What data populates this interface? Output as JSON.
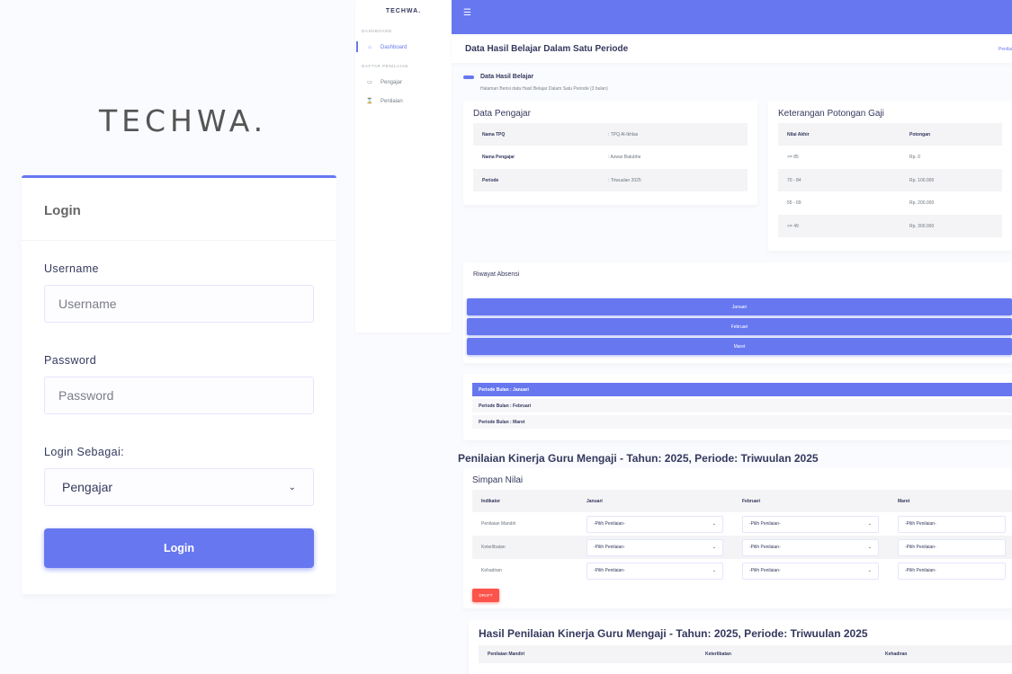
{
  "login": {
    "brand": "TECHWA.",
    "title": "Login",
    "username_label": "Username",
    "username_placeholder": "Username",
    "password_label": "Password",
    "password_placeholder": "Password",
    "role_label": "Login Sebagai:",
    "role_value": "Pengajar",
    "submit_label": "Login"
  },
  "sidebar": {
    "brand": "TECHWA.",
    "head_1": "DASHBOARD",
    "item_dashboard": "Dashboard",
    "head_2": "DAFTAR PENILAIAN",
    "item_pengajar": "Pengajar",
    "item_penilaian": "Penilaian"
  },
  "page": {
    "title": "Data Hasil Belajar Dalam Satu Periode",
    "breadcrumb": "Penilai",
    "section_title": "Data Hasil Belajar",
    "section_sub": "Halaman Berisi data Hasil Belajar Dalam Satu Periode (3 bulan)"
  },
  "pengajar": {
    "title": "Data Pengajar",
    "rows": [
      {
        "k": "Nama TPQ",
        "v": ": TPQ Al-Ikhlas"
      },
      {
        "k": "Nama Pengajar",
        "v": ": Azwar Batubhe"
      },
      {
        "k": "Periode",
        "v": ": Triwuulan 2025"
      }
    ]
  },
  "potongan": {
    "title": "Keterangan Potongan Gaji",
    "head": [
      "Nilai Akhir",
      "Potongan"
    ],
    "rows": [
      [
        ">= 85",
        "Rp. 0"
      ],
      [
        "70 - 84",
        "Rp. 100.000"
      ],
      [
        "55 - 69",
        "Rp. 200.000"
      ],
      [
        "<= 49",
        "Rp. 300.000"
      ]
    ]
  },
  "absensi": {
    "title": "Riwayat Absensi",
    "months": [
      "Januari",
      "Februari",
      "Maret"
    ]
  },
  "periode": {
    "items": [
      "Periode Bulan : Januari",
      "Periode Bulan : Februari",
      "Periode Bulan : Maret"
    ]
  },
  "penilaian": {
    "heading": "Penilaian Kinerja Guru Mengaji - Tahun: 2025, Periode: Triwuulan 2025",
    "card_title": "Simpan Nilai",
    "head": [
      "Indikator",
      "Januari",
      "Februari",
      "Maret"
    ],
    "rows": [
      "Penilaian Mandiri",
      "Keterlibatan",
      "Kehadiran"
    ],
    "select_placeholder": "-Pilih Penilaian-",
    "draft_label": "DRAFT"
  },
  "hasil": {
    "heading": "Hasil Penilaian Kinerja Guru Mengaji - Tahun: 2025, Periode: Triwuulan 2025",
    "head": [
      "Penilaian Mandiri",
      "Keterlibatan",
      "Kehadiran"
    ]
  },
  "colors": {
    "primary": "#6777ef",
    "danger": "#fc544b"
  }
}
